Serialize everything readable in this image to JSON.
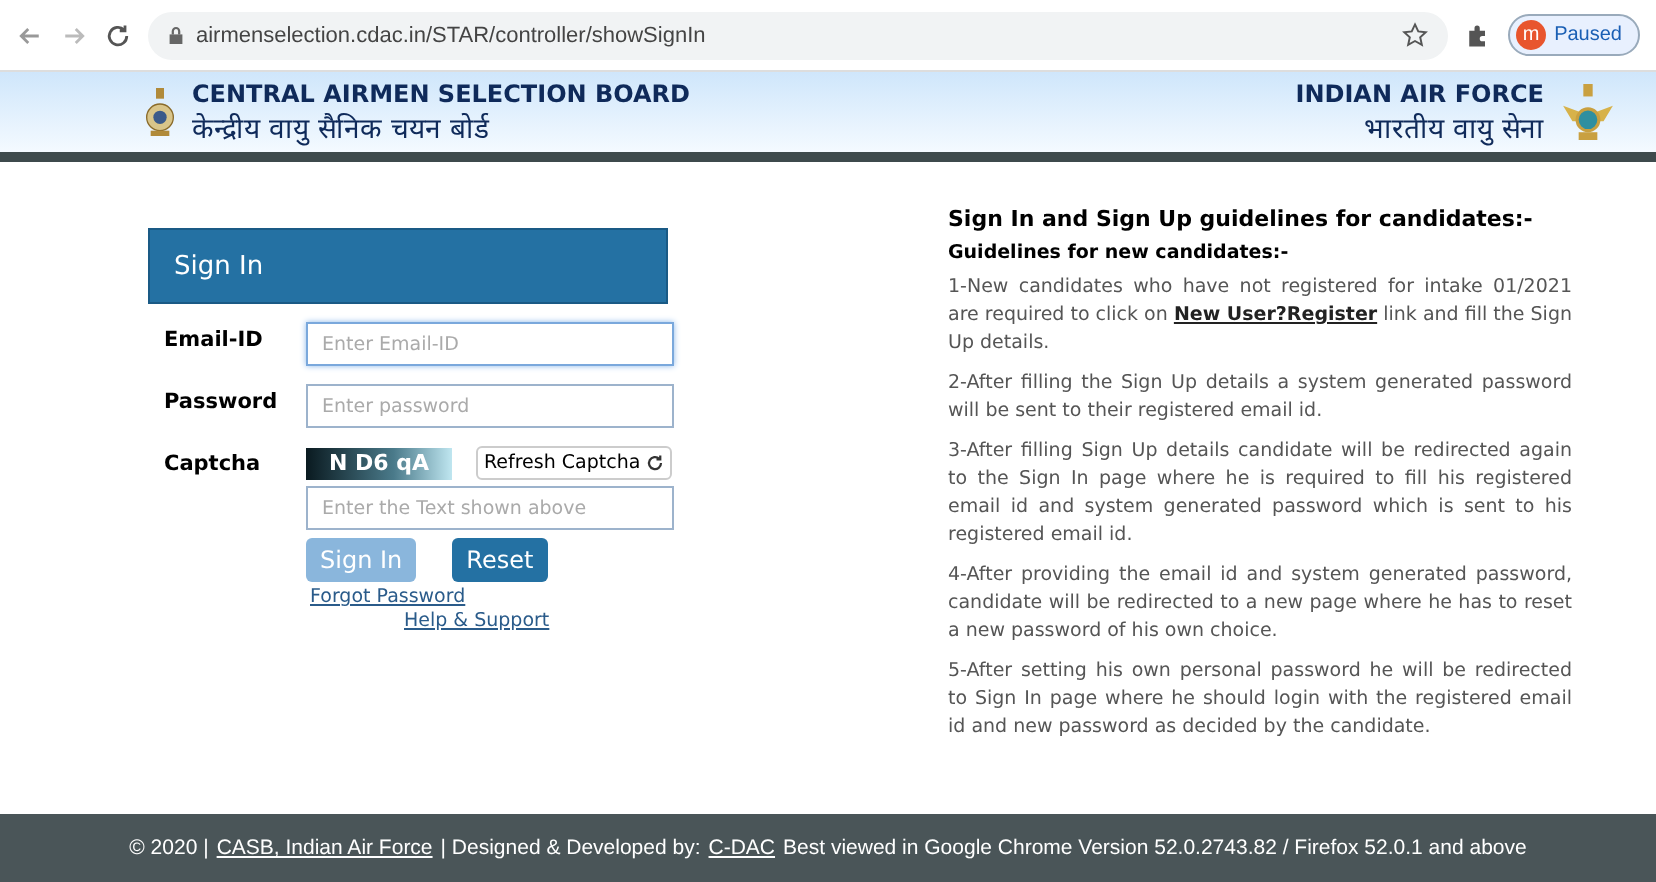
{
  "browser": {
    "url": "airmenselection.cdac.in/STAR/controller/showSignIn",
    "profile_initial": "m",
    "profile_status": "Paused"
  },
  "header": {
    "left_title": "CENTRAL AIRMEN SELECTION BOARD",
    "left_subtitle": "केन्द्रीय वायु सैनिक चयन बोर्ड",
    "right_title": "INDIAN AIR FORCE",
    "right_subtitle": "भारतीय वायु सेना"
  },
  "signin": {
    "title": "Sign In",
    "fields": [
      {
        "kind": "input",
        "label": "Email-ID",
        "placeholder": "Enter Email-ID",
        "focused": true
      },
      {
        "kind": "input",
        "label": "Password",
        "placeholder": "Enter password",
        "focused": false
      },
      {
        "kind": "captcha",
        "label": "Captcha",
        "captcha_text": "N D6 qA",
        "refresh": "Refresh Captcha",
        "placeholder": "Enter the Text shown above",
        "focused": false
      }
    ],
    "buttons": [
      {
        "label": "Sign In",
        "disabled": true
      },
      {
        "label": "Reset",
        "disabled": false
      }
    ],
    "links": [
      "Forgot Password",
      "Help & Support"
    ]
  },
  "guidelines": {
    "title": "Sign In and Sign Up guidelines for candidates:-",
    "subtitle": "Guidelines for new candidates:-",
    "items": [
      {
        "parts": [
          {
            "text": "1-New candidates who have not registered for intake 01/2021 are required to click on "
          },
          {
            "text": "New User?Register",
            "link": true
          },
          {
            "text": " link and fill the Sign Up details."
          }
        ]
      },
      {
        "parts": [
          {
            "text": "2-After filling the Sign Up details a system generated password will be sent to their registered email id."
          }
        ]
      },
      {
        "parts": [
          {
            "text": "3-After filling Sign Up details candidate will be redirected again to the Sign In page where he is required to fill his registered email id and system generated password which is sent to his registered email id."
          }
        ]
      },
      {
        "parts": [
          {
            "text": "4-After providing the email id and system generated password, candidate will be redirected to a new page where he has to reset a new password of his own choice."
          }
        ]
      },
      {
        "parts": [
          {
            "text": "5-After setting his own personal password he will be redirected to Sign In page where he should login with the registered email id and new password as decided by the candidate."
          }
        ]
      }
    ]
  },
  "footer": [
    {
      "text": "© 2020 |"
    },
    {
      "text": "CASB, Indian Air Force",
      "link": true
    },
    {
      "text": "| Designed & Developed by:"
    },
    {
      "text": "C-DAC",
      "link": true
    },
    {
      "text": "Best viewed in Google Chrome Version 52.0.2743.82 / Firefox 52.0.1 and above"
    }
  ]
}
